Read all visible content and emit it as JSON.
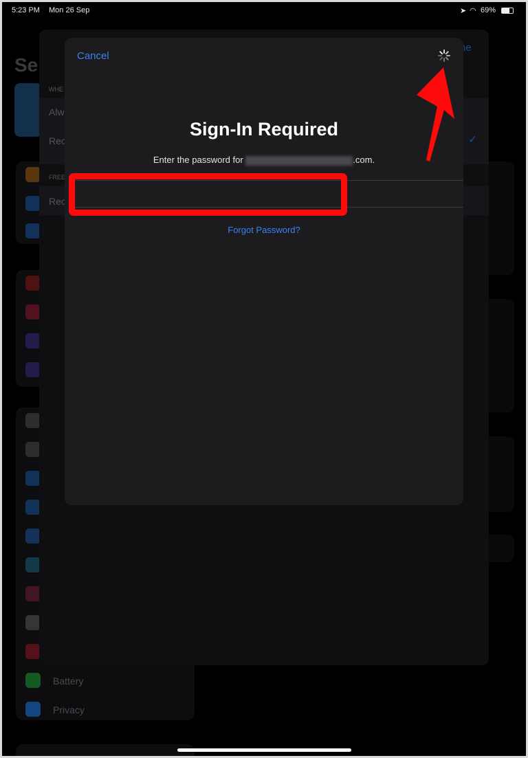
{
  "status_bar": {
    "time": "5:23 PM",
    "date": "Mon 26 Sep",
    "battery": "69%",
    "icons": [
      "location-icon",
      "wifi-icon",
      "battery-icon"
    ]
  },
  "background": {
    "settings_title": "Se",
    "done_fragment": "ne",
    "sheet_rows": [
      "WHE",
      "Alw",
      "Rec",
      "FREE",
      "Rec"
    ],
    "sidebar_items": [
      "Battery",
      "Privacy"
    ]
  },
  "modal": {
    "cancel_label": "Cancel",
    "title": "Sign-In Required",
    "subtitle_prefix": "Enter the password for ",
    "subtitle_suffix": ".com.",
    "password_value": "",
    "forgot_label": "Forgot Password?",
    "activity": "loading-spinner-icon"
  },
  "colors": {
    "accent": "#3b82f0",
    "annotation": "#ff0a0a",
    "modal_bg": "#1c1c1f"
  }
}
